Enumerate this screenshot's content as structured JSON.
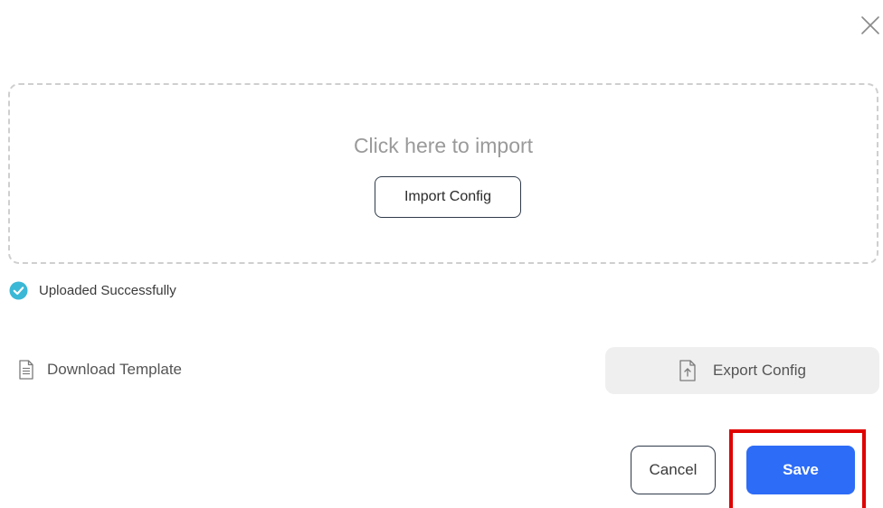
{
  "dialog": {
    "close_icon": "close-icon"
  },
  "dropzone": {
    "title": "Click here to import",
    "import_button_label": "Import Config"
  },
  "upload_status": {
    "icon": "check-circle-icon",
    "icon_color": "#3bb8d6",
    "text": "Uploaded Successfully"
  },
  "template": {
    "icon": "document-icon",
    "label": "Download Template"
  },
  "export": {
    "icon": "file-upload-icon",
    "label": "Export Config"
  },
  "footer": {
    "cancel_label": "Cancel",
    "save_label": "Save",
    "save_color": "#2d6cf6",
    "highlight_color": "#e00000"
  }
}
